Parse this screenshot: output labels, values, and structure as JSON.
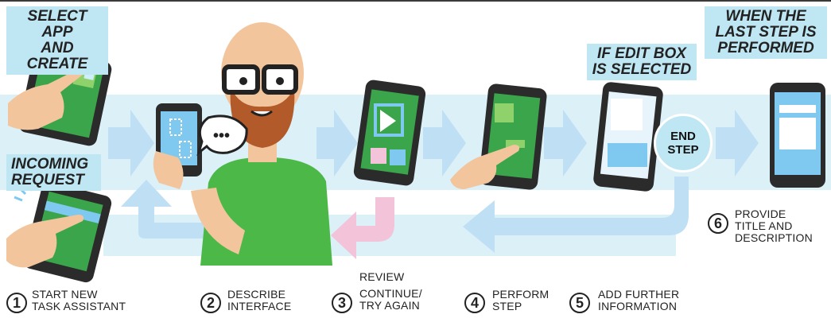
{
  "labels": {
    "select_app_line1": "SELECT APP",
    "select_app_line2": "AND CREATE",
    "incoming_line1": "INCOMING",
    "incoming_line2": "REQUEST",
    "edit_box_line1": "IF EDIT BOX",
    "edit_box_line2": "IS SELECTED",
    "last_step_line1": "WHEN THE",
    "last_step_line2": "LAST STEP IS",
    "last_step_line3": "PERFORMED",
    "end_step_line1": "END",
    "end_step_line2": "STEP"
  },
  "steps": [
    {
      "number": "1",
      "line1": "START NEW",
      "line2": "TASK ASSISTANT"
    },
    {
      "number": "2",
      "line1": "DESCRIBE",
      "line2": "INTERFACE"
    },
    {
      "number": "3",
      "line0": "REVIEW",
      "line1": "CONTINUE/",
      "line2": "TRY AGAIN"
    },
    {
      "number": "4",
      "line1": "PERFORM",
      "line2": "STEP"
    },
    {
      "number": "5",
      "line1": "ADD FURTHER",
      "line2": "INFORMATION"
    },
    {
      "number": "6",
      "line1": "PROVIDE",
      "line2": "TITLE AND",
      "line3": "DESCRIPTION"
    }
  ],
  "speech_bubble": "•••",
  "colors": {
    "band": "#dcf0f8",
    "label_box": "#bfe6f3",
    "arrow": "#bfe0f4",
    "arrow_pink": "#f3c3da",
    "phone": "#2b2b2b",
    "screen_green": "#3aa54a",
    "shirt_green": "#4cb848",
    "skin": "#f2c59c",
    "beard": "#b35a2a"
  }
}
